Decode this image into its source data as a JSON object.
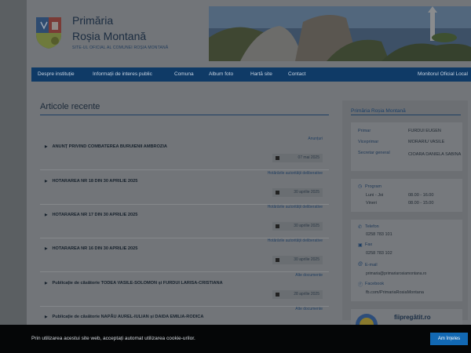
{
  "header": {
    "title_line1": "Primăria",
    "title_line2": "Roșia Montană",
    "subtitle": "SITE-UL OFICIAL AL COMUNEI ROȘIA MONTANĂ"
  },
  "nav": {
    "items": [
      "Despre instituție",
      "Informații de interes public",
      "Comuna",
      "Album foto",
      "Hartă site",
      "Contact"
    ],
    "right": "Monitorul Oficial Local"
  },
  "main": {
    "section_title": "Articole recente",
    "articles": [
      {
        "category": "Anunțuri",
        "title": "ANUNȚ PRIVIND COMBATEREA BURUIENII AMBROZIA",
        "date": "07 mai 2025"
      },
      {
        "category": "Hotărârile autorității deliberative",
        "title": "HOTARAREA NR 18 DIN 30 APRILIE 2025",
        "date": "30 aprilie 2025"
      },
      {
        "category": "Hotărârile autorității deliberative",
        "title": "HOTARAREA NR 17 DIN 30 APRILIE 2025",
        "date": "30 aprilie 2025"
      },
      {
        "category": "Hotărârile autorității deliberative",
        "title": "HOTARAREA NR 16 DIN 30 APRILIE 2025",
        "date": "30 aprilie 2025"
      },
      {
        "category": "Alte documente",
        "title": "Publicație de căsătorie TODEA VASILE-SOLOMON și FURDUI LARISA-CRISTIANA",
        "date": "28 aprilie 2025"
      },
      {
        "category": "Alte documente",
        "title": "Publicație de căsătorie NAPĂU AUREL-IULIAN și DAIDA EMILIA-RODICA",
        "date": ""
      }
    ]
  },
  "sidebar": {
    "heading": "Primăria Roșia Montană",
    "officials": [
      {
        "role": "Primar",
        "name": "FURDUI EUGEN"
      },
      {
        "role": "Viceprimar",
        "name": "MORARIU VASILE"
      },
      {
        "role": "Secretar general",
        "name": "CIOARA DANIELA SABINA"
      }
    ],
    "program": {
      "label": "Program",
      "rows": [
        {
          "days": "Luni - Joi",
          "hours": "08.00 - 16.00"
        },
        {
          "days": "Vineri",
          "hours": "08.00 - 15.00"
        }
      ]
    },
    "contact": {
      "phone_label": "Telefon",
      "phone": "0258 783 101",
      "fax_label": "Fax",
      "fax": "0258 783 102",
      "email_label": "E-mail",
      "email": "primaria@primariarosiamontana.ro",
      "facebook_label": "Facebook",
      "facebook": "fb.com/PrimariaRosiaMontana"
    },
    "badge": "fiipregătit.ro"
  },
  "cookie": {
    "message": "Prin utilizarea acestui site web, acceptați automat utilizarea cookie-urilor.",
    "button": "Am înțeles"
  },
  "colors": {
    "nav": "#0f3a66",
    "accent": "#1268b3",
    "overlay_bg": "#727579"
  }
}
